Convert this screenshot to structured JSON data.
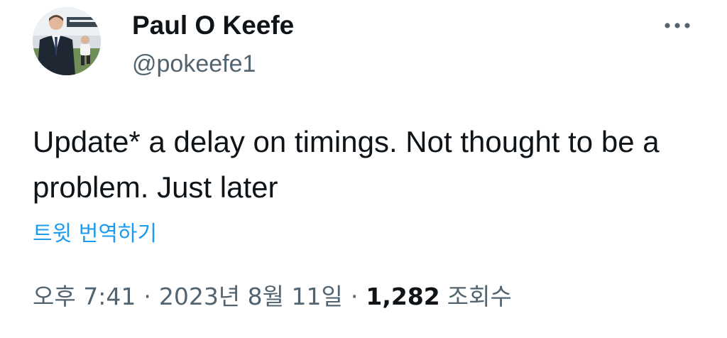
{
  "author": {
    "display_name": "Paul O Keefe",
    "handle": "@pokeefe1",
    "avatar_icon": "profile-photo"
  },
  "tweet": {
    "text": "Update* a delay on timings. Not thought to be a problem. Just later",
    "translate_label": "트윗 번역하기"
  },
  "meta": {
    "time": "오후 7:41",
    "separator": "·",
    "date": "2023년 8월 11일",
    "views_count": "1,282",
    "views_label": "조회수"
  },
  "actions": {
    "more_icon": "more-options-icon"
  },
  "colors": {
    "text": "#0f1419",
    "secondary": "#536471",
    "link": "#1d9bf0",
    "background": "#ffffff"
  }
}
